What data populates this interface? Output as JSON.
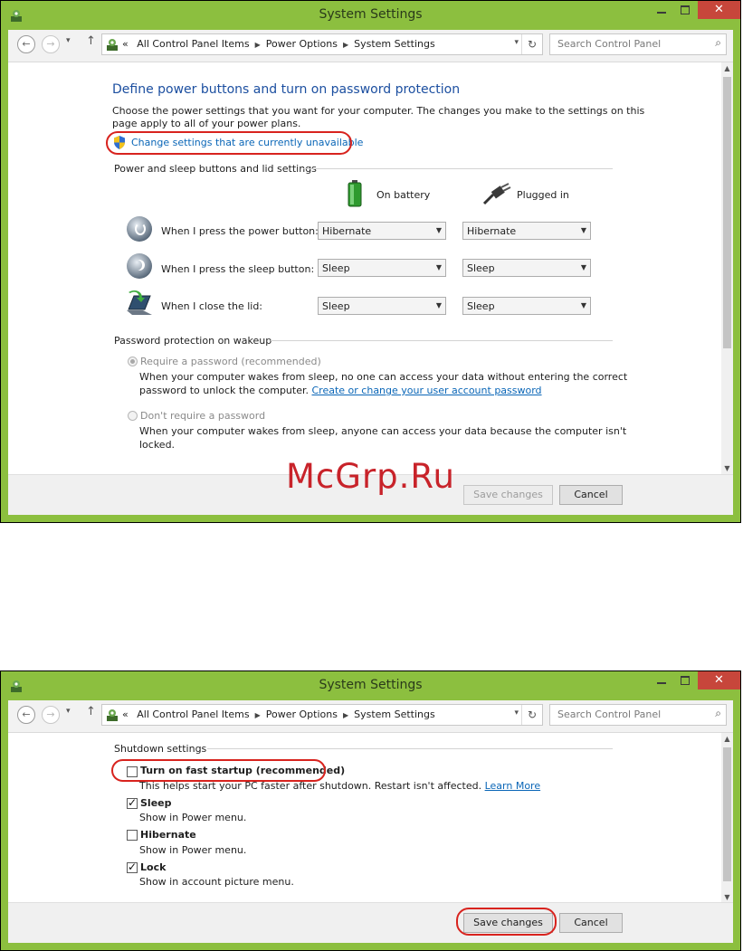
{
  "window": {
    "title": "System Settings",
    "close_glyph": "✕"
  },
  "nav": {
    "back_glyph": "←",
    "forward_glyph": "→",
    "dropdown_glyph": "▾",
    "up_glyph": "↑",
    "breadcrumb_prefix": "«",
    "breadcrumbs": [
      "All Control Panel Items",
      "Power Options",
      "System Settings"
    ],
    "refresh_glyph": "↻",
    "search_placeholder": "Search Control Panel",
    "search_glyph": "⌕"
  },
  "top_panel": {
    "heading": "Define power buttons and turn on password protection",
    "description_line1": "Choose the power settings that you want for your computer. The changes you make to the settings on this",
    "description_line2": "page apply to all of your power plans.",
    "change_settings_link": "Change settings that are currently unavailable",
    "section_power_title": "Power and sleep buttons and lid settings",
    "on_battery": "On battery",
    "plugged_in": "Plugged in",
    "rows": [
      {
        "label": "When I press the power button:",
        "battery": "Hibernate",
        "plugged": "Hibernate",
        "icon": "power-button-icon"
      },
      {
        "label": "When I press the sleep button:",
        "battery": "Sleep",
        "plugged": "Sleep",
        "icon": "sleep-button-icon"
      },
      {
        "label": "When I close the lid:",
        "battery": "Sleep",
        "plugged": "Sleep",
        "icon": "laptop-lid-icon"
      }
    ],
    "section_password_title": "Password protection on wakeup",
    "require_label": "Require a password (recommended)",
    "require_desc_line1": "When your computer wakes from sleep, no one can access your data without entering the correct",
    "require_desc_line2_prefix": "password to unlock the computer.",
    "require_link": "Create or change your user account password",
    "dont_require_label": "Don't require a password",
    "dont_require_desc_line1": "When your computer wakes from sleep, anyone can access your data because the computer isn't",
    "dont_require_desc_line2": "locked.",
    "require_selected": true,
    "save_label": "Save changes",
    "cancel_label": "Cancel"
  },
  "bottom_panel": {
    "section_shutdown_title": "Shutdown settings",
    "fast_startup_label": "Turn on fast startup (recommended)",
    "fast_startup_desc": "This helps start your PC faster after shutdown. Restart isn't affected.",
    "learn_more": "Learn More",
    "fast_startup_checked": false,
    "sleep_label": "Sleep",
    "sleep_desc": "Show in Power menu.",
    "sleep_checked": true,
    "hibernate_label": "Hibernate",
    "hibernate_desc": "Show in Power menu.",
    "hibernate_checked": false,
    "lock_label": "Lock",
    "lock_desc": "Show in account picture menu.",
    "lock_checked": true,
    "save_label": "Save changes",
    "cancel_label": "Cancel"
  },
  "watermark": "McGrp.Ru",
  "colors": {
    "window_frame": "#8cbf3f",
    "heading_blue": "#1c4fa0",
    "link_blue": "#0a66b7",
    "annotation_red": "#d8231e",
    "close_red": "#c7463b"
  }
}
